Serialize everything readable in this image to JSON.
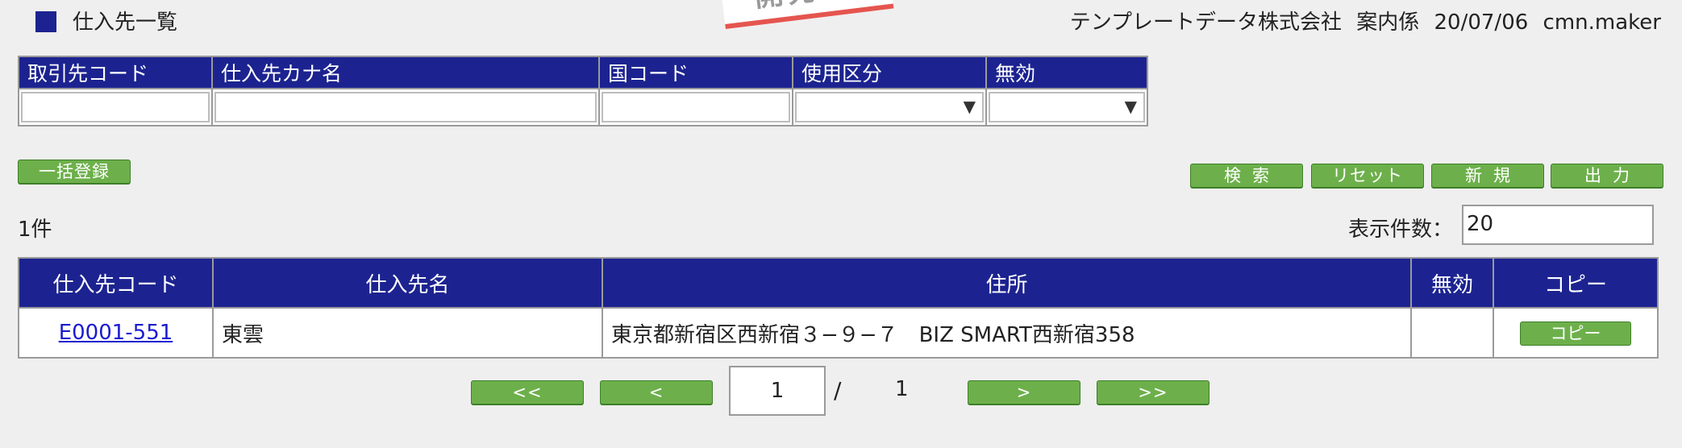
{
  "header": {
    "title": "仕入先一覧",
    "stamp_text": "開発",
    "company": "テンプレートデータ株式会社",
    "role": "案内係",
    "date": "20/07/06",
    "user": "cmn.maker"
  },
  "filter": {
    "columns": [
      "取引先コード",
      "仕入先カナ名",
      "国コード",
      "使用区分",
      "無効"
    ],
    "values": {
      "code": "",
      "kana": "",
      "country": "",
      "usage": "",
      "invalid": ""
    }
  },
  "buttons": {
    "bulk_register": "一括登録",
    "search": "検索",
    "reset": "リセット",
    "new": "新規",
    "output": "出力"
  },
  "result_count": "1件",
  "per_page": {
    "label": "表示件数：",
    "value": "20"
  },
  "results": {
    "columns": [
      "仕入先コード",
      "仕入先名",
      "住所",
      "無効",
      "コピー"
    ],
    "rows": [
      {
        "code": "E0001-551",
        "name": "東雲",
        "address": "東京都新宿区西新宿３−９−７　BIZ SMART西新宿358",
        "invalid": "",
        "copy_label": "コピー"
      }
    ]
  },
  "pagination": {
    "first": "<<",
    "prev": "<",
    "current": "1",
    "separator": "/",
    "total": "1",
    "next": ">",
    "last": ">>"
  },
  "colors": {
    "header_bg": "#1c2390",
    "button_green": "#6db04b",
    "link": "#1a1ad0",
    "stamp_red": "#e5554f"
  }
}
